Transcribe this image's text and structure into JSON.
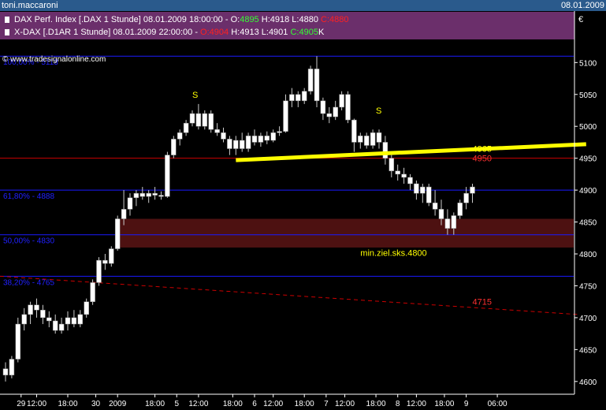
{
  "window": {
    "user": "toni.maccaroni",
    "date": "08.01.2009"
  },
  "legend": [
    {
      "name": "DAX Perf. Index [.DAX  1 Stunde] 08.01.2009 18:00:00 - ",
      "o_label": "O:",
      "o": "4895",
      "h_label": " H:",
      "h": "4918",
      "l_label": " L:",
      "l": "4880",
      "c_label": " C:",
      "c": "4880"
    },
    {
      "name": "X-DAX [.D1AR  1 Stunde] 08.01.2009 22:00:00 - ",
      "o_label": "O:",
      "o": "4904",
      "h_label": " H:",
      "h": "4913",
      "l_label": " L:",
      "l": "4901",
      "c_label": " C:",
      "c": "4905",
      "c_suffix": "K"
    }
  ],
  "colors": {
    "bg": "#000000",
    "up": "#ffffff",
    "down": "#ffffff",
    "axis": "#ffffff",
    "hline": "#1a1aff",
    "red": "#cc0000",
    "neckline": "#ffff00",
    "zone": "#5a1414",
    "fib_text": "#2020ff",
    "annot": "#ffff00"
  },
  "chart_data": {
    "type": "candlestick",
    "currency_symbol": "€",
    "watermark": "© www.tradesignalonline.com",
    "y_ticks": [
      4600,
      4650,
      4700,
      4750,
      4800,
      4850,
      4900,
      4950,
      5000,
      5050,
      5100
    ],
    "ylim": [
      4580,
      5135
    ],
    "x_ticks": [
      {
        "label": "29",
        "i": 2.5
      },
      {
        "label": "12:00",
        "i": 5
      },
      {
        "label": "18:00",
        "i": 10
      },
      {
        "label": "30",
        "i": 14.5
      },
      {
        "label": "2009",
        "i": 18
      },
      {
        "label": "18:00",
        "i": 24
      },
      {
        "label": "5",
        "i": 27.5
      },
      {
        "label": "12:00",
        "i": 31
      },
      {
        "label": "18:00",
        "i": 36.5
      },
      {
        "label": "6",
        "i": 40
      },
      {
        "label": "12:00",
        "i": 43
      },
      {
        "label": "18:00",
        "i": 48
      },
      {
        "label": "7",
        "i": 51.5
      },
      {
        "label": "12:00",
        "i": 54.5
      },
      {
        "label": "18:00",
        "i": 59.5
      },
      {
        "label": "8",
        "i": 63
      },
      {
        "label": "12:00",
        "i": 66
      },
      {
        "label": "18:00",
        "i": 70.5
      },
      {
        "label": "9",
        "i": 74
      },
      {
        "label": "06:00",
        "i": 79
      }
    ],
    "ohlc": [
      [
        4620,
        4630,
        4600,
        4610
      ],
      [
        4610,
        4640,
        4605,
        4635
      ],
      [
        4635,
        4700,
        4630,
        4690
      ],
      [
        4690,
        4715,
        4680,
        4705
      ],
      [
        4705,
        4725,
        4690,
        4720
      ],
      [
        4720,
        4730,
        4700,
        4712
      ],
      [
        4712,
        4720,
        4690,
        4700
      ],
      [
        4700,
        4710,
        4685,
        4695
      ],
      [
        4695,
        4705,
        4675,
        4680
      ],
      [
        4680,
        4700,
        4675,
        4690
      ],
      [
        4690,
        4710,
        4680,
        4700
      ],
      [
        4700,
        4712,
        4685,
        4690
      ],
      [
        4690,
        4712,
        4685,
        4705
      ],
      [
        4705,
        4730,
        4700,
        4725
      ],
      [
        4725,
        4760,
        4720,
        4755
      ],
      [
        4755,
        4795,
        4750,
        4790
      ],
      [
        4790,
        4800,
        4775,
        4785
      ],
      [
        4785,
        4812,
        4780,
        4808
      ],
      [
        4808,
        4860,
        4805,
        4855
      ],
      [
        4855,
        4900,
        4845,
        4870
      ],
      [
        4870,
        4895,
        4860,
        4888
      ],
      [
        4888,
        4900,
        4875,
        4895
      ],
      [
        4895,
        4905,
        4885,
        4890
      ],
      [
        4890,
        4900,
        4880,
        4895
      ],
      [
        4895,
        4905,
        4885,
        4892
      ],
      [
        4892,
        4898,
        4885,
        4890
      ],
      [
        4890,
        4960,
        4888,
        4955
      ],
      [
        4955,
        4985,
        4950,
        4980
      ],
      [
        4980,
        4995,
        4970,
        4990
      ],
      [
        4990,
        5010,
        4985,
        5005
      ],
      [
        5005,
        5025,
        5000,
        5020
      ],
      [
        5020,
        5035,
        4995,
        5000
      ],
      [
        5000,
        5025,
        4995,
        5020
      ],
      [
        5020,
        5025,
        4990,
        4995
      ],
      [
        4995,
        5005,
        4985,
        4990
      ],
      [
        4990,
        4998,
        4975,
        4980
      ],
      [
        4980,
        4985,
        4955,
        4965
      ],
      [
        4965,
        4985,
        4955,
        4978
      ],
      [
        4978,
        4990,
        4960,
        4965
      ],
      [
        4965,
        4990,
        4960,
        4985
      ],
      [
        4985,
        4995,
        4970,
        4975
      ],
      [
        4975,
        4990,
        4968,
        4985
      ],
      [
        4985,
        4992,
        4972,
        4978
      ],
      [
        4978,
        4995,
        4975,
        4990
      ],
      [
        4990,
        5000,
        4985,
        4992
      ],
      [
        4992,
        5050,
        4990,
        5040
      ],
      [
        5040,
        5060,
        5030,
        5050
      ],
      [
        5050,
        5055,
        5030,
        5040
      ],
      [
        5040,
        5060,
        5035,
        5055
      ],
      [
        5055,
        5095,
        5050,
        5090
      ],
      [
        5090,
        5110,
        5030,
        5040
      ],
      [
        5040,
        5045,
        5010,
        5020
      ],
      [
        5020,
        5030,
        5005,
        5015
      ],
      [
        5015,
        5040,
        5010,
        5030
      ],
      [
        5030,
        5055,
        5025,
        5050
      ],
      [
        5050,
        5055,
        5005,
        5010
      ],
      [
        5010,
        5012,
        4960,
        4975
      ],
      [
        4975,
        4990,
        4965,
        4985
      ],
      [
        4985,
        4990,
        4965,
        4970
      ],
      [
        4970,
        4995,
        4965,
        4990
      ],
      [
        4990,
        4995,
        4965,
        4975
      ],
      [
        4975,
        4985,
        4940,
        4950
      ],
      [
        4950,
        4955,
        4920,
        4930
      ],
      [
        4930,
        4940,
        4915,
        4925
      ],
      [
        4925,
        4935,
        4910,
        4920
      ],
      [
        4920,
        4925,
        4900,
        4910
      ],
      [
        4910,
        4915,
        4885,
        4895
      ],
      [
        4895,
        4910,
        4880,
        4905
      ],
      [
        4905,
        4910,
        4875,
        4880
      ],
      [
        4880,
        4900,
        4860,
        4870
      ],
      [
        4870,
        4885,
        4845,
        4855
      ],
      [
        4855,
        4870,
        4830,
        4840
      ],
      [
        4840,
        4865,
        4830,
        4860
      ],
      [
        4860,
        4885,
        4855,
        4880
      ],
      [
        4880,
        4905,
        4870,
        4895
      ],
      [
        4895,
        4910,
        4880,
        4905
      ]
    ],
    "h_lines": [
      {
        "value": 5110,
        "color": "#1a1aff",
        "label": "100,00% - 5113"
      },
      {
        "value": 4900,
        "color": "#1a1aff",
        "label": "61,80% - 4888"
      },
      {
        "value": 4830,
        "color": "#1a1aff",
        "label": "50,00% - 4830"
      },
      {
        "value": 4765,
        "color": "#1a1aff",
        "label": "38,20% - 4765"
      },
      {
        "value": 4950,
        "color": "#cc0000",
        "label": ""
      }
    ],
    "zone": {
      "from": 4810,
      "to": 4855
    },
    "neckline": {
      "i0": 37,
      "v0": 4947,
      "i1": 92,
      "v1": 4972
    },
    "dashed_line": {
      "i0": 0,
      "v0": 4765,
      "i1": 92,
      "v1": 4705
    },
    "annotations": [
      {
        "text": "S",
        "i": 30,
        "v": 5045,
        "color": "#ffff00"
      },
      {
        "text": "S",
        "i": 59.5,
        "v": 5020,
        "color": "#ffff00"
      },
      {
        "text": "4965",
        "i": 75,
        "v": 4960,
        "color": "#ffff00"
      },
      {
        "text": "4950",
        "i": 75,
        "v": 4945,
        "color": "#ff3030"
      },
      {
        "text": "min.ziel.sks.4800",
        "i": 57,
        "v": 4797,
        "color": "#ffff00"
      },
      {
        "text": "4715",
        "i": 75,
        "v": 4720,
        "color": "#ff3030"
      }
    ]
  }
}
